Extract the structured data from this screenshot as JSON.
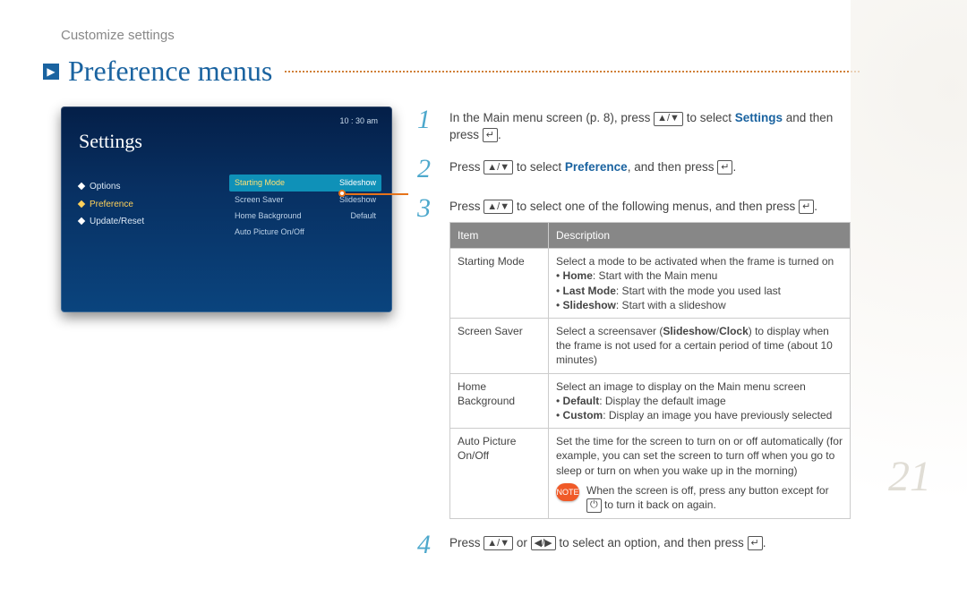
{
  "breadcrumb": "Customize settings",
  "title": "Preference menus",
  "pagenum": "21",
  "screenshot": {
    "time": "10 : 30 am",
    "heading": "Settings",
    "left": [
      {
        "label": "Options"
      },
      {
        "label": "Preference",
        "on": true
      },
      {
        "label": "Update/Reset"
      }
    ],
    "right": [
      {
        "label": "Starting Mode",
        "value": "Slideshow",
        "hl": true
      },
      {
        "label": "Screen Saver",
        "value": "Slideshow"
      },
      {
        "label": "Home Background",
        "value": "Default"
      },
      {
        "label": "Auto Picture On/Off",
        "value": ""
      }
    ]
  },
  "steps": {
    "s1a": "In the Main menu screen (p. 8), press ",
    "s1b": " to select ",
    "s1c": "Settings",
    "s1d": " and then press ",
    "s2a": "Press ",
    "s2b": " to select ",
    "s2c": "Preference",
    "s2d": ", and then press ",
    "s3a": "Press ",
    "s3b": " to select one of the following menus, and then press ",
    "s4a": "Press ",
    "s4b": " or ",
    "s4c": " to select an option, and then press "
  },
  "table": {
    "h1": "Item",
    "h2": "Description",
    "rows": [
      {
        "item": "Starting Mode",
        "body": "Select a mode to be activated when the frame is turned on",
        "bullets": [
          {
            "b": "Home",
            "t": ": Start with the Main menu"
          },
          {
            "b": "Last Mode",
            "t": ": Start with the mode you used last"
          },
          {
            "b": "Slideshow",
            "t": ": Start with a slideshow"
          }
        ]
      },
      {
        "item": "Screen Saver",
        "body_pre": "Select a screensaver (",
        "body_b1": "Slideshow",
        "body_mid": "/",
        "body_b2": "Clock",
        "body_post": ") to display when the frame is not used for a certain period of time (about 10 minutes)"
      },
      {
        "item": "Home Background",
        "body": "Select an image to display on the Main menu screen",
        "bullets": [
          {
            "b": "Default",
            "t": ": Display the default image"
          },
          {
            "b": "Custom",
            "t": ": Display an image you have previously selected"
          }
        ]
      },
      {
        "item": "Auto Picture On/Off",
        "body": "Set the time for the screen to turn on or off automatically (for example, you can set the screen to turn off when you go to sleep or turn on when you wake up in the morning)",
        "note_pre": "When the screen is off, press any button except for ",
        "note_post": " to turn it back on again."
      }
    ]
  }
}
